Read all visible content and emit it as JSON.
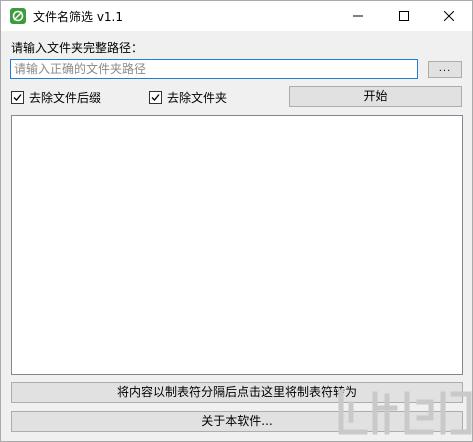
{
  "window": {
    "title": "文件名筛选 v1.1",
    "app_icon": "app-logo-icon",
    "controls": [
      "minimize-icon",
      "maximize-icon",
      "close-icon"
    ]
  },
  "path": {
    "label": "请输入文件夹完整路径：",
    "value": "",
    "placeholder": "请输入正确的文件夹路径",
    "browse_label": "..."
  },
  "options": {
    "remove_extension": {
      "label": "去除文件后缀",
      "checked": true
    },
    "remove_folders": {
      "label": "去除文件夹",
      "checked": true
    }
  },
  "buttons": {
    "start": "开始",
    "convert": "将内容以制表符分隔后点击这里将制表符转为",
    "about": "关于本软件..."
  },
  "output": {
    "text": ""
  },
  "colors": {
    "input_focus_border": "#1f7fd6",
    "button_face": "#e1e1e1",
    "window_bg": "#f0f0f0",
    "watermark": "#c9c9c9"
  }
}
